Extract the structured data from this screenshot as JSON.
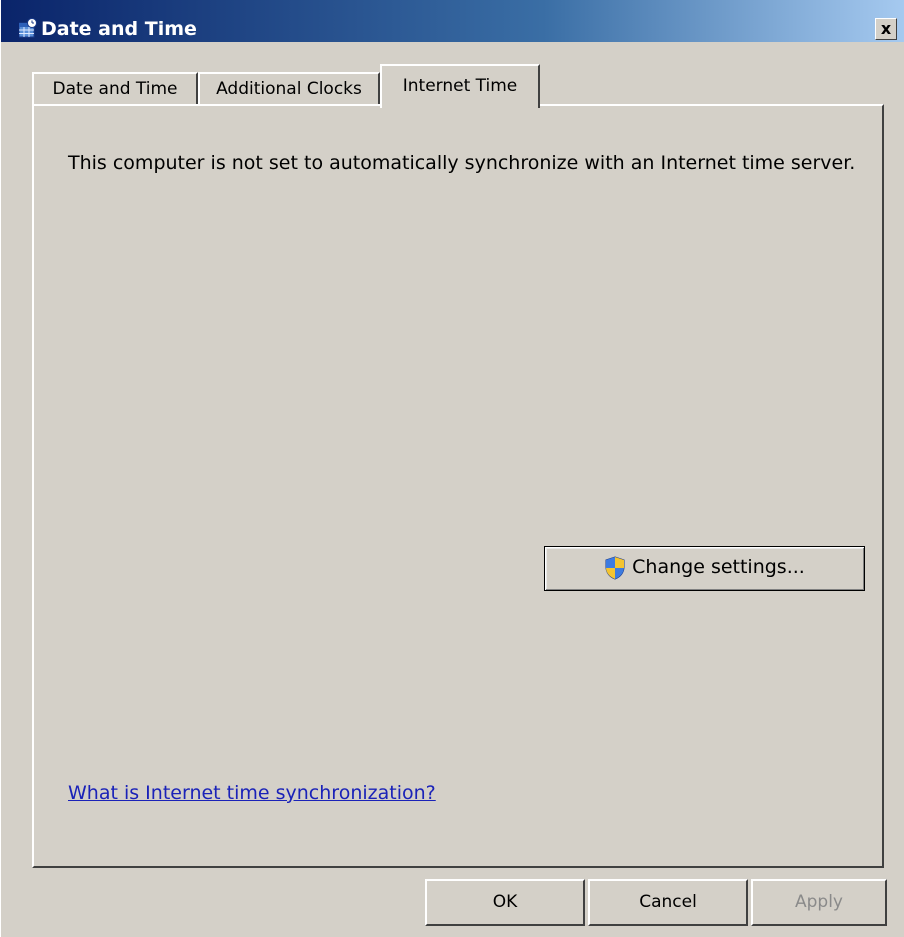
{
  "window": {
    "title": "Date and Time",
    "close_label": "x"
  },
  "tabs": [
    {
      "label": "Date and Time",
      "active": false
    },
    {
      "label": "Additional Clocks",
      "active": false
    },
    {
      "label": "Internet Time",
      "active": true
    }
  ],
  "panel": {
    "status_text": "This computer is not set to automatically synchronize with an Internet time server.",
    "change_settings_label": "Change settings...",
    "help_link_text": "What is Internet time synchronization?"
  },
  "footer": {
    "ok_label": "OK",
    "cancel_label": "Cancel",
    "apply_label": "Apply",
    "apply_enabled": false
  },
  "icons": {
    "window_icon": "date-time-icon",
    "uac_icon": "uac-shield-icon"
  },
  "colors": {
    "titlebar_start": "#0a246a",
    "titlebar_end": "#a6caf0",
    "face": "#d4d0c8",
    "link": "#1a22b8"
  }
}
